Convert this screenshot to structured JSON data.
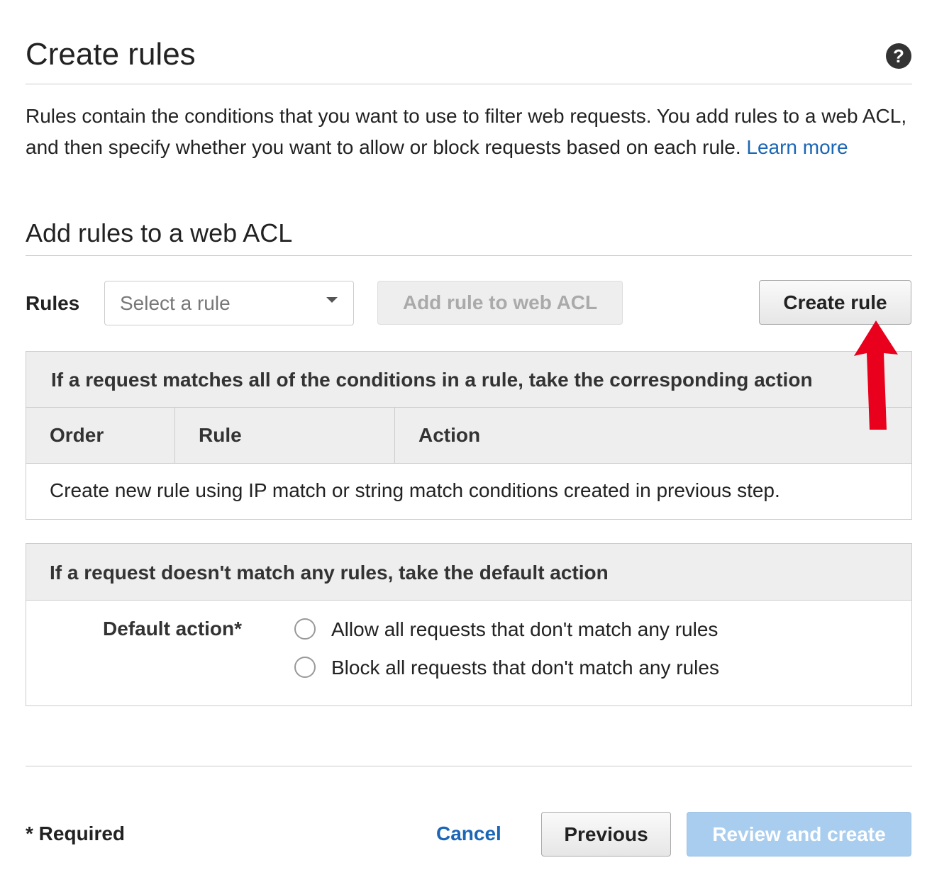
{
  "header": {
    "title": "Create rules",
    "help_icon": "question-circle-icon"
  },
  "description": {
    "text": "Rules contain the conditions that you want to use to filter web requests. You add rules to a web ACL, and then specify whether you want to allow or block requests based on each rule.",
    "link": "Learn more"
  },
  "section": {
    "title": "Add rules to a web ACL"
  },
  "rules_row": {
    "label": "Rules",
    "select_placeholder": "Select a rule",
    "add_button": "Add rule to web ACL",
    "create_button": "Create rule"
  },
  "rules_table": {
    "header": "If a request matches all of the conditions in a rule, take the corresponding action",
    "columns": [
      "Order",
      "Rule",
      "Action"
    ],
    "empty_message": "Create new rule using IP match or string match conditions created in previous step."
  },
  "default_table": {
    "header": "If a request doesn't match any rules, take the default action",
    "label": "Default action*",
    "options": [
      "Allow all requests that don't match any rules",
      "Block all requests that don't match any rules"
    ]
  },
  "footer": {
    "required": "* Required",
    "cancel": "Cancel",
    "previous": "Previous",
    "review": "Review and create"
  },
  "annotation": {
    "arrow_color": "#e8001c"
  },
  "colors": {
    "link": "#1b66b5",
    "primary_disabled": "#a9cdee"
  }
}
